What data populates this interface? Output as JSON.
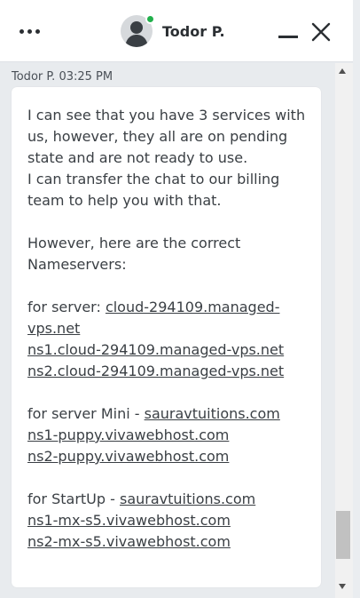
{
  "header": {
    "agent_name": "Todor P.",
    "status": "online",
    "status_color": "#21b04b",
    "icons": [
      "more-options-icon",
      "agent-avatar",
      "minimize-icon",
      "close-icon"
    ]
  },
  "message": {
    "meta": "Todor P. 03:25 PM",
    "line1": "I can see that you have 3 services with us, however, they all are on pending state and are not ready to use.",
    "line2": "I can transfer the chat to our billing team to help you with that.",
    "line3": "However, here are the correct Nameservers:",
    "server_prefix": "for server: ",
    "server_domain": "cloud-294109.managed-vps.net",
    "server_ns1": "ns1.cloud-294109.managed-vps.net",
    "server_ns2": "ns2.cloud-294109.managed-vps.net",
    "mini_prefix": "for server Mini - ",
    "mini_domain": "sauravtuitions.com",
    "mini_ns1": "ns1-puppy.vivawebhost.com",
    "mini_ns2": "ns2-puppy.vivawebhost.com",
    "startup_prefix": "for StartUp - ",
    "startup_domain": "sauravtuitions.com",
    "startup_ns1": "ns1-mx-s5.vivawebhost.com",
    "startup_ns2": "ns2-mx-s5.vivawebhost.com"
  }
}
